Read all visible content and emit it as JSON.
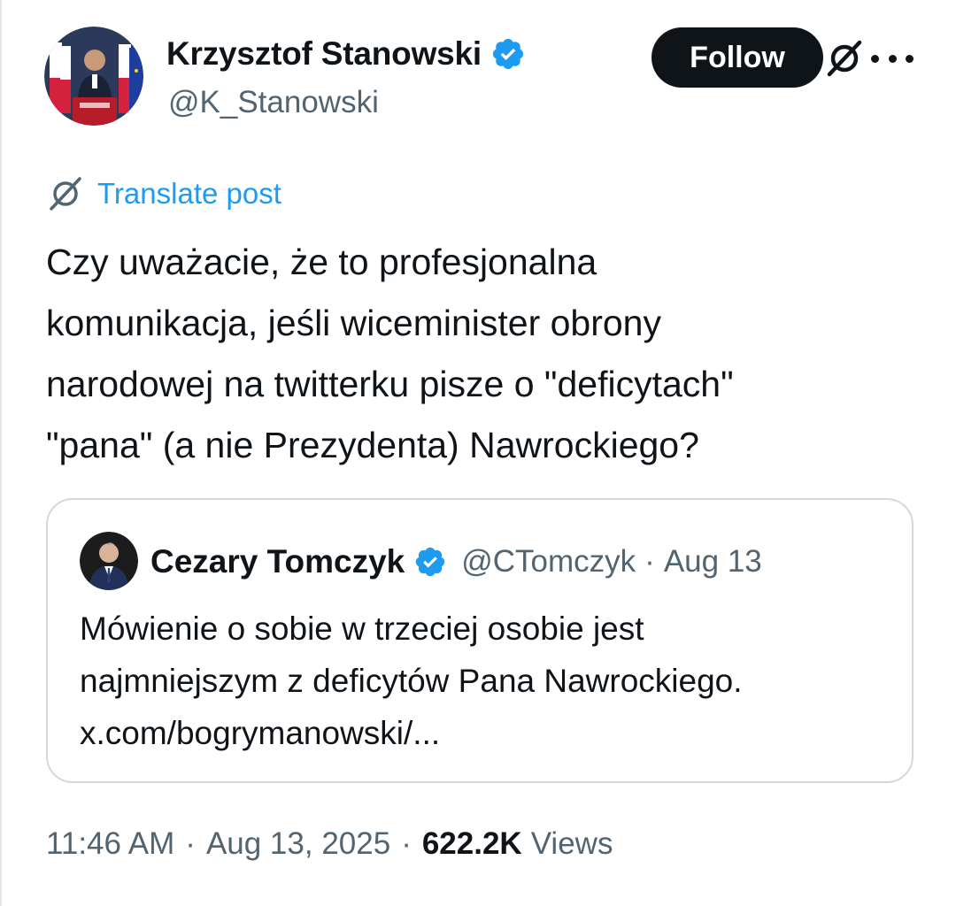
{
  "author": {
    "name": "Krzysztof Stanowski",
    "handle": "@K_Stanowski",
    "verified": true
  },
  "actions": {
    "follow_label": "Follow"
  },
  "translate": {
    "label": "Translate post"
  },
  "post": {
    "lines": [
      "Czy uważacie, że to profesjonalna",
      "komunikacja, jeśli wiceminister obrony",
      "narodowej na twitterku pisze o \"deficytach\"",
      "\"pana\" (a nie Prezydenta) Nawrockiego?"
    ]
  },
  "quote": {
    "name": "Cezary Tomczyk",
    "handle": "@CTomczyk",
    "separator": "·",
    "date": "Aug 13",
    "verified": true,
    "lines": [
      "Mówienie o sobie w trzeciej osobie jest",
      "najmniejszym z deficytów Pana Nawrockiego.",
      "x.com/bogrymanowski/..."
    ]
  },
  "meta": {
    "time": "11:46 AM",
    "separator": "·",
    "date": "Aug 13, 2025",
    "views_count": "622.2K",
    "views_label": "Views"
  },
  "colors": {
    "text": "#0f1419",
    "secondary": "#536471",
    "accent": "#1d9bf0",
    "border": "#cfd9de",
    "button_bg": "#0f1419"
  },
  "icons": {
    "verified": "verified-badge-icon",
    "grok": "grok-icon",
    "more": "more-options-icon",
    "translate": "grok-translate-icon"
  }
}
